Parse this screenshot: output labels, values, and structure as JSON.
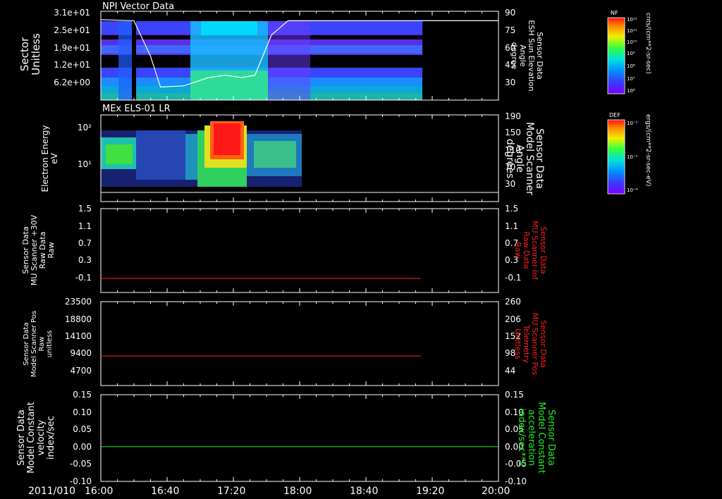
{
  "time_axis": {
    "date": "2011/010",
    "ticks": [
      "16:00",
      "16:40",
      "17:20",
      "18:00",
      "18:40",
      "19:20",
      "20:00"
    ],
    "range": [
      "16:00",
      "20:00"
    ]
  },
  "colors": {
    "red_trace": "#ff2020",
    "green_trace": "#22ee22",
    "white_trace": "#ffffff",
    "frame": "#ffffff",
    "right_red_label": "#ff2020",
    "right_green_label": "#22ee22"
  },
  "panels": [
    {
      "id": "npi",
      "title": "NPI Vector Data",
      "left_label": [
        "Sector",
        "Unitless"
      ],
      "right_label": [
        "Sensor Data",
        "ESH Sun Elevation",
        "Angle",
        "degree"
      ],
      "left_ticks": [
        "3.1e+01",
        "2.5e+01",
        "1.9e+01",
        "1.2e+01",
        "6.2e+00"
      ],
      "right_ticks": [
        "90",
        "75",
        "60",
        "45",
        "30"
      ]
    },
    {
      "id": "els",
      "title": "MEx ELS-01 LR",
      "left_label": [
        "Electron Energy",
        "eV"
      ],
      "right_label": [
        "Sensor Data",
        "Model Scanner",
        "Angle",
        "degrees"
      ],
      "left_ticks": [
        "10²",
        "10¹"
      ],
      "right_ticks": [
        "190",
        "150",
        "110",
        "70",
        "30"
      ]
    },
    {
      "id": "mu_raw",
      "left_label": [
        "Sensor Data",
        "MU Scanner +30V",
        "Raw Data",
        "Raw"
      ],
      "right_label": [
        "Sensor Data",
        "MU Scanner Inf",
        "Raw Data",
        "Raw"
      ],
      "left_ticks": [
        "1.5",
        "1.1",
        "0.7",
        "0.3",
        "-0.1"
      ],
      "right_ticks": [
        "1.5",
        "1.1",
        "0.7",
        "0.3",
        "-0.1"
      ]
    },
    {
      "id": "pos",
      "left_label": [
        "Sensor Data",
        "Model Scanner Pos",
        "Raw",
        "unitless"
      ],
      "right_label": [
        "Sensor Data",
        "MU Scanner Pos",
        "Telemetry",
        "Unitless"
      ],
      "left_ticks": [
        "23500",
        "18800",
        "14100",
        "9400",
        "4700"
      ],
      "right_ticks": [
        "260",
        "206",
        "152",
        "98",
        "44"
      ]
    },
    {
      "id": "vel",
      "left_label": [
        "Sensor Data",
        "Model Constant",
        "velocity",
        "index/sec"
      ],
      "right_label": [
        "Sensor Data",
        "Model Constant",
        "acceleration",
        "index/sec**2"
      ],
      "left_ticks": [
        "0.15",
        "0.10",
        "0.05",
        "0.00",
        "-0.05",
        "-0.10"
      ],
      "right_ticks": [
        "0.15",
        "0.10",
        "0.05",
        "0.00",
        "-0.05",
        "-0.10"
      ]
    }
  ],
  "colorbars": [
    {
      "label": "NF",
      "unit": "cnts/(cm**2-sr-sec)",
      "ticks": [
        "10¹²",
        "10¹¹",
        "10¹⁰",
        "10⁹",
        "10⁸",
        "10⁷",
        "10⁶"
      ]
    },
    {
      "label": "DEF",
      "unit": "ergs/(cm**2-sr-sec-eV)",
      "ticks": [
        "10⁻²",
        "10⁻³",
        "10⁻⁴"
      ]
    }
  ],
  "chart_data": [
    {
      "type": "heatmap",
      "title": "NPI Vector Data",
      "xlabel": "",
      "ylabel": "Sector Unitless",
      "xlim": [
        "16:00",
        "20:00"
      ],
      "ylim": [
        0,
        31
      ],
      "data_end": "19:13",
      "overlay_line": {
        "name": "Sensor Data ESH Sun Elevation Angle degree",
        "ylim": [
          15,
          90
        ],
        "points": [
          [
            "16:00",
            83
          ],
          [
            "16:20",
            82
          ],
          [
            "16:30",
            52
          ],
          [
            "16:36",
            26
          ],
          [
            "16:50",
            27
          ],
          [
            "17:05",
            34
          ],
          [
            "17:15",
            36
          ],
          [
            "17:25",
            34
          ],
          [
            "17:33",
            36
          ],
          [
            "17:43",
            70
          ],
          [
            "17:53",
            82
          ],
          [
            "18:30",
            82
          ],
          [
            "19:20",
            82
          ],
          [
            "20:00",
            82
          ]
        ]
      }
    },
    {
      "type": "heatmap",
      "title": "MEx ELS-01 LR",
      "ylabel": "Electron Energy eV",
      "xlim": [
        "16:00",
        "20:00"
      ],
      "data_range": [
        "16:00",
        "18:00"
      ],
      "overlay_line": {
        "name": "Sensor Data Model Scanner Angle degrees",
        "value": 0,
        "ylim": [
          0,
          190
        ]
      }
    },
    {
      "type": "line",
      "series": [
        {
          "name": "Sensor Data MU Scanner +30V Raw Data Raw",
          "x": [
            "16:00",
            "19:13"
          ],
          "values": [
            0,
            0
          ]
        }
      ],
      "ylim": [
        -0.3,
        1.5
      ]
    },
    {
      "type": "line",
      "series": [
        {
          "name": "Sensor Data Model Scanner Pos Raw unitless",
          "x": [
            "16:00",
            "19:13"
          ],
          "values": [
            8300,
            8300
          ]
        }
      ],
      "ylim": [
        0,
        23500
      ]
    },
    {
      "type": "line",
      "series": [
        {
          "name": "Sensor Data Model Constant velocity index/sec",
          "x": [
            "16:00",
            "20:00"
          ],
          "values": [
            0,
            0
          ]
        }
      ],
      "ylim": [
        -0.1,
        0.15
      ]
    }
  ]
}
